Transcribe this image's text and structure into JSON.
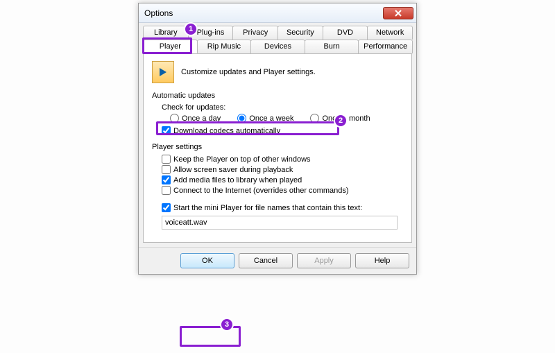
{
  "window": {
    "title": "Options"
  },
  "tabs_row1": [
    "Library",
    "Plug-ins",
    "Privacy",
    "Security",
    "DVD",
    "Network"
  ],
  "tabs_row2": [
    "Player",
    "Rip Music",
    "Devices",
    "Burn",
    "Performance"
  ],
  "active_tab": "Player",
  "intro_text": "Customize updates and Player settings.",
  "auto_updates": {
    "group_title": "Automatic updates",
    "check_label": "Check for updates:",
    "radios": [
      "Once a day",
      "Once a week",
      "Once a month"
    ],
    "selected_radio": 1,
    "download_codecs_label": "Download codecs automatically",
    "download_codecs_checked": true
  },
  "player_settings": {
    "group_title": "Player settings",
    "items": [
      {
        "label": "Keep the Player on top of other windows",
        "checked": false
      },
      {
        "label": "Allow screen saver during playback",
        "checked": false
      },
      {
        "label": "Add media files to library when played",
        "checked": true
      },
      {
        "label": "Connect to the Internet (overrides other commands)",
        "checked": false
      }
    ],
    "mini_label": "Start the mini Player for file names that contain this text:",
    "mini_checked": true,
    "mini_value": "voiceatt.wav"
  },
  "buttons": {
    "ok": "OK",
    "cancel": "Cancel",
    "apply": "Apply",
    "help": "Help"
  },
  "annotations": {
    "b1": "1",
    "b2": "2",
    "b3": "3"
  }
}
